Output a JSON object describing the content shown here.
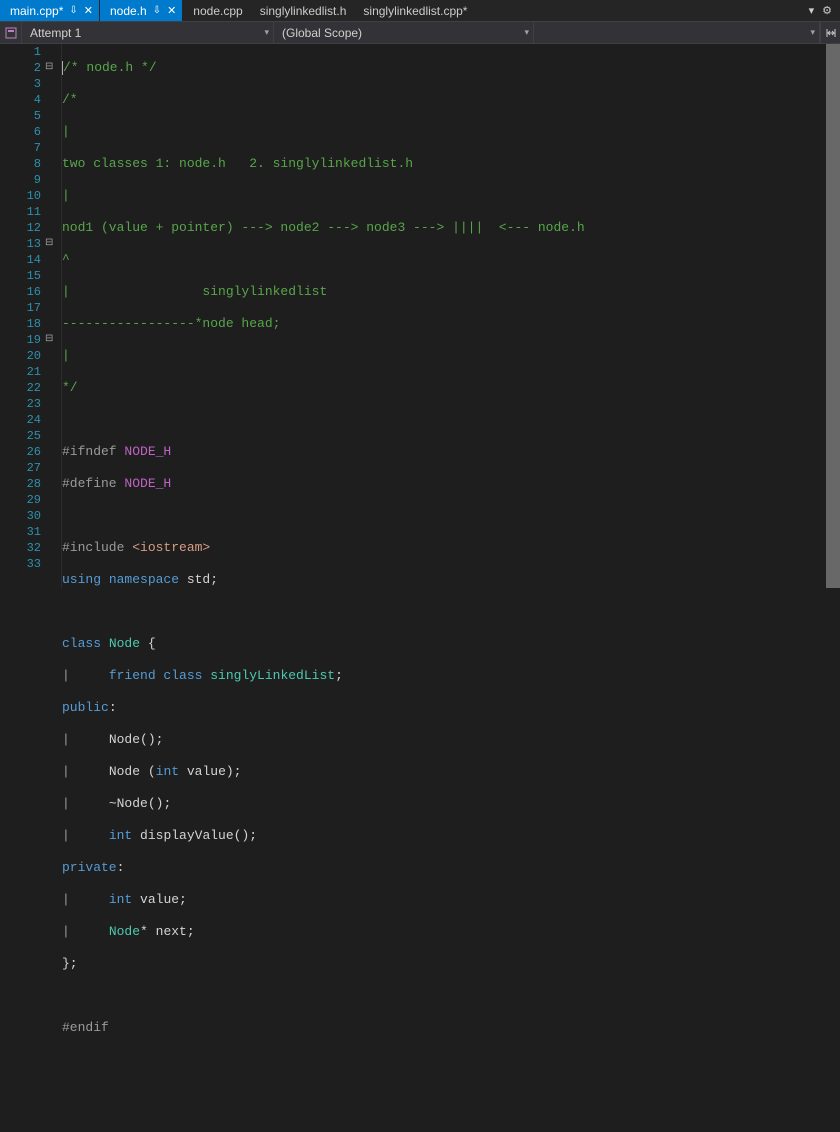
{
  "tabs": [
    {
      "label": "main.cpp*",
      "active": true,
      "pinned": true,
      "closable": true
    },
    {
      "label": "node.h",
      "active": true,
      "pinned": true,
      "closable": true
    },
    {
      "label": "node.cpp",
      "active": false,
      "pinned": false,
      "closable": false
    },
    {
      "label": "singlylinkedlist.h",
      "active": false,
      "pinned": false,
      "closable": false
    },
    {
      "label": "singlylinkedlist.cpp*",
      "active": false,
      "pinned": false,
      "closable": false
    }
  ],
  "scope": {
    "left": "Attempt 1",
    "middle": "(Global Scope)",
    "right": ""
  },
  "icons": {
    "pin": "⇩",
    "close": "✕",
    "dropdown": "▾",
    "gear": "⚙",
    "fold_minus": "⊟",
    "split": "↔"
  },
  "lineCount": 33,
  "code": {
    "l1": "/* node.h */",
    "l2": "/*",
    "l3": "|",
    "l4": "two classes 1: node.h   2. singlylinkedlist.h",
    "l5": "|",
    "l6": "nod1 (value + pointer) ---> node2 ---> node3 ---> ||||  <--- node.h",
    "l7": "^",
    "l8": "|                 singlylinkedlist",
    "l9": "-----------------*node head;",
    "l10": "|",
    "l11": "*/",
    "l12": "",
    "l13a": "#ifndef ",
    "l13b": "NODE_H",
    "l14a": "#define ",
    "l14b": "NODE_H",
    "l15": "",
    "l16a": "#include ",
    "l16b": "<iostream>",
    "l17a": "using",
    "l17b": " namespace",
    "l17c": " std;",
    "l18": "",
    "l19a": "class",
    "l19b": " Node",
    "l19c": " {",
    "l20a": "    friend",
    "l20b": " class",
    "l20c": " singlyLinkedList",
    "l20d": ";",
    "l21a": "public",
    "l21b": ":",
    "l22a": "    ",
    "l22b": "Node",
    "l22c": "();",
    "l23a": "    ",
    "l23b": "Node",
    "l23c": " (",
    "l23d": "int",
    "l23e": " value);",
    "l24a": "    ~",
    "l24b": "Node",
    "l24c": "();",
    "l25a": "    ",
    "l25b": "int",
    "l25c": " displayValue();",
    "l26a": "private",
    "l26b": ":",
    "l27a": "    ",
    "l27b": "int",
    "l27c": " value;",
    "l28a": "    ",
    "l28b": "Node",
    "l28c": "* next;",
    "l29": "};",
    "l30": "",
    "l31": "#endif",
    "l32": "",
    "l33": ""
  }
}
